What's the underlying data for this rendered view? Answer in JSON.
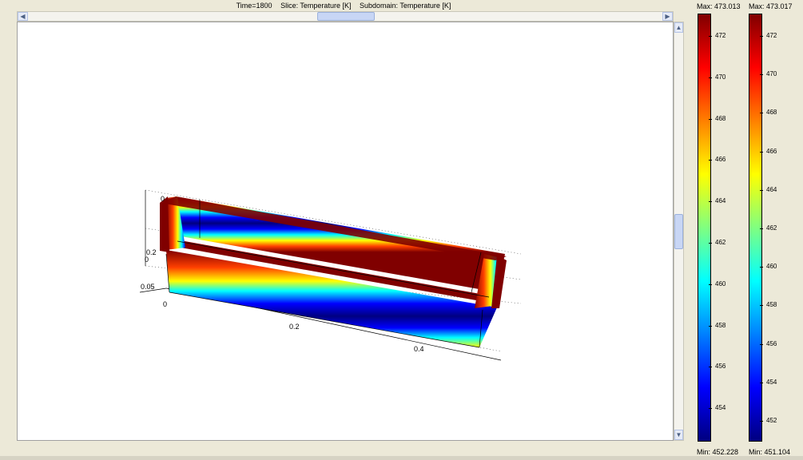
{
  "header": {
    "time": "Time=1800",
    "slice": "Slice: Temperature [K]",
    "subdomain": "Subdomain: Temperature [K]"
  },
  "axes": {
    "y_labels": [
      "0",
      "0.2",
      "0"
    ],
    "z_label": "0.05",
    "x_labels": [
      "0",
      "0.2",
      "0.4"
    ]
  },
  "colorbars": [
    {
      "max": "Max: 473.013",
      "min": "Min: 452.228",
      "ticks": [
        "472",
        "470",
        "468",
        "466",
        "464",
        "462",
        "460",
        "458",
        "456",
        "454"
      ]
    },
    {
      "max": "Max: 473.017",
      "min": "Min: 451.104",
      "ticks": [
        "472",
        "470",
        "468",
        "466",
        "464",
        "462",
        "460",
        "458",
        "456",
        "454",
        "452"
      ]
    }
  ],
  "colors": {
    "jet": [
      "#800000",
      "#ff0000",
      "#ff8000",
      "#ffff00",
      "#80ff80",
      "#00ffff",
      "#0080ff",
      "#0000ff",
      "#000080"
    ]
  }
}
